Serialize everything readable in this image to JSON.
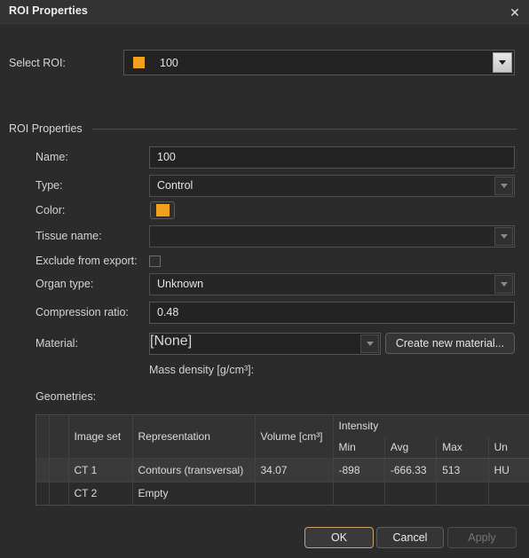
{
  "window": {
    "title": "ROI Properties",
    "close_icon": "close-icon"
  },
  "select_roi": {
    "label": "Select ROI:",
    "value": "100",
    "swatch_color": "#f0a11e",
    "arrow_icon": "chevron-down-icon"
  },
  "group": {
    "title": "ROI Properties"
  },
  "fields": {
    "name": {
      "label": "Name:",
      "value": "100"
    },
    "type": {
      "label": "Type:",
      "value": "Control"
    },
    "color": {
      "label": "Color:",
      "value": "#f0a11e"
    },
    "tissue_name": {
      "label": "Tissue name:",
      "value": ""
    },
    "exclude_from_export": {
      "label": "Exclude from export:",
      "checked": false
    },
    "organ_type": {
      "label": "Organ type:",
      "value": "Unknown"
    },
    "compression_ratio": {
      "label": "Compression ratio:",
      "value": "0.48"
    },
    "material": {
      "label": "Material:",
      "value": "[None]"
    },
    "create_material_button": "Create new material...",
    "mass_density": "Mass density [g/cm³]:",
    "geometries_label": "Geometries:"
  },
  "table": {
    "group_headers": {
      "image_set": "Image set",
      "representation": "Representation",
      "volume": "Volume [cm³]",
      "intensity": "Intensity"
    },
    "sub_headers": {
      "min": "Min",
      "avg": "Avg",
      "max": "Max",
      "unit": "Un"
    },
    "rows": [
      {
        "image_set": "CT 1",
        "representation": "Contours (transversal)",
        "volume": "34.07",
        "min": "-898",
        "avg": "-666.33",
        "max": "513",
        "unit": "HU",
        "selected": true
      },
      {
        "image_set": "CT 2",
        "representation": "Empty",
        "volume": "",
        "min": "",
        "avg": "",
        "max": "",
        "unit": "",
        "selected": false
      }
    ]
  },
  "footer": {
    "ok": "OK",
    "cancel": "Cancel",
    "apply": "Apply"
  }
}
